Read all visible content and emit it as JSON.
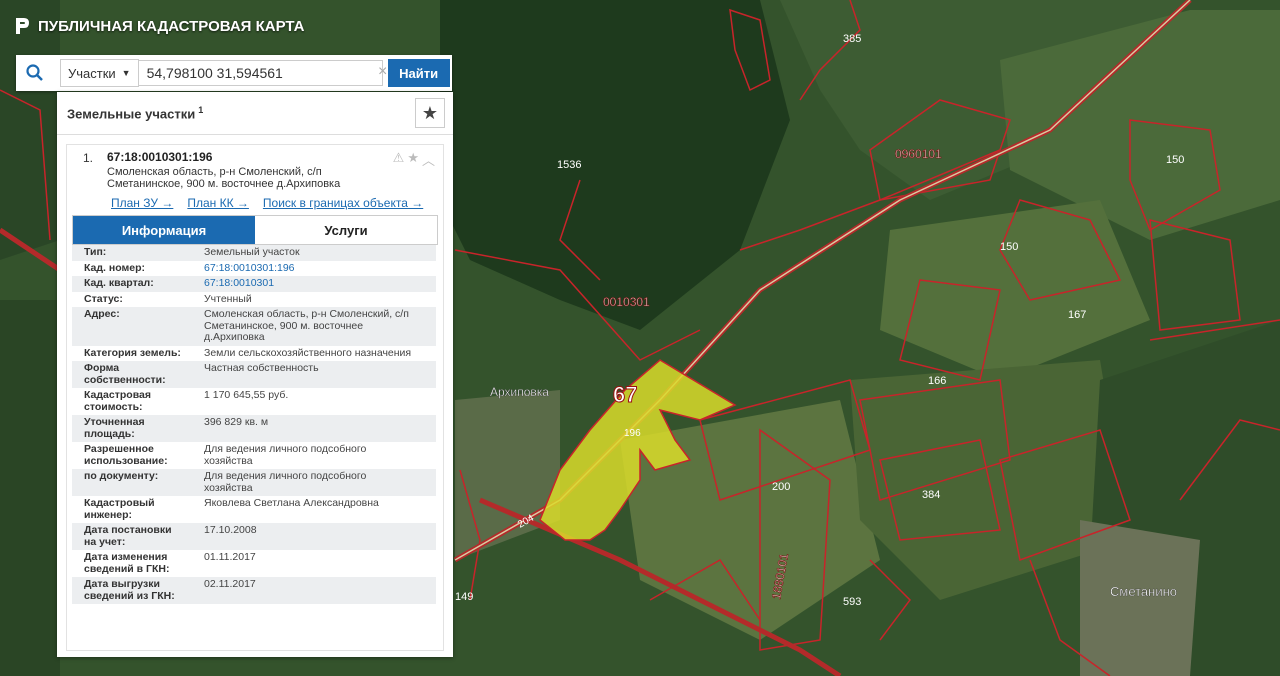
{
  "app_title": "ПУБЛИЧНАЯ КАДАСТРОВАЯ КАРТА",
  "search": {
    "dropdown": "Участки",
    "query": "54,798100 31,594561",
    "find_label": "Найти"
  },
  "panel": {
    "title": "Земельные участки",
    "count": "1"
  },
  "result": {
    "index": "1.",
    "kad_number": "67:18:0010301:196",
    "address_lines": [
      "Смоленская область, р-н Смоленский, с/п",
      "Сметанинское, 900 м. восточнее д.Архиповка"
    ],
    "links": [
      "План ЗУ →",
      "План КК →",
      "Поиск в границах объекта →"
    ],
    "tabs": [
      "Информация",
      "Услуги"
    ]
  },
  "info_rows": [
    {
      "label": [
        "Тип:"
      ],
      "value": [
        "Земельный участок"
      ]
    },
    {
      "label": [
        "Кад. номер:"
      ],
      "value": [
        "67:18:0010301:196"
      ],
      "link": true
    },
    {
      "label": [
        "Кад. квартал:"
      ],
      "value": [
        "67:18:0010301"
      ],
      "link": true
    },
    {
      "label": [
        "Статус:"
      ],
      "value": [
        "Учтенный"
      ]
    },
    {
      "label": [
        "Адрес:"
      ],
      "value": [
        "Смоленская область, р-н Смоленский, с/п",
        "Сметанинское, 900 м. восточнее",
        "д.Архиповка"
      ]
    },
    {
      "label": [
        "Категория земель:"
      ],
      "value": [
        "Земли сельскохозяйственного назначения"
      ]
    },
    {
      "label": [
        "Форма",
        "собственности:"
      ],
      "value": [
        "Частная собственность"
      ]
    },
    {
      "label": [
        "Кадастровая",
        "стоимость:"
      ],
      "value": [
        "1 170 645,55 руб."
      ]
    },
    {
      "label": [
        "Уточненная",
        "площадь:"
      ],
      "value": [
        "396 829 кв. м"
      ]
    },
    {
      "label": [
        "Разрешенное",
        "использование:"
      ],
      "value": [
        "Для ведения личного подсобного",
        "хозяйства"
      ]
    },
    {
      "label": [
        "по документу:"
      ],
      "value": [
        "Для ведения личного подсобного",
        "хозяйства"
      ]
    },
    {
      "label": [
        "Кадастровый",
        "инженер:"
      ],
      "value": [
        "Яковлева Светлана Александровна"
      ]
    },
    {
      "label": [
        "Дата постановки",
        "на учет:"
      ],
      "value": [
        "17.10.2008"
      ]
    },
    {
      "label": [
        "Дата изменения",
        "сведений в ГКН:"
      ],
      "value": [
        "01.11.2017"
      ]
    },
    {
      "label": [
        "Дата выгрузки",
        "сведений из ГКН:"
      ],
      "value": [
        "02.11.2017"
      ]
    }
  ],
  "map_labels": {
    "quarter_main": "0010301",
    "quarter_ne": "0960101",
    "quarter_se": "1880101",
    "region": "67",
    "parcel": "196",
    "village_arkh": "Архиповка",
    "village_smet": "Сметанино",
    "road": "204",
    "n385": "385",
    "n1536": "1536",
    "n150a": "150",
    "n150b": "150",
    "n167": "167",
    "n166": "166",
    "n200": "200",
    "n384": "384",
    "n593": "593",
    "n149": "149"
  },
  "colors": {
    "accent": "#1b6ab1",
    "parcel_fill": "#d9dc2a",
    "boundary": "#c8242a"
  }
}
